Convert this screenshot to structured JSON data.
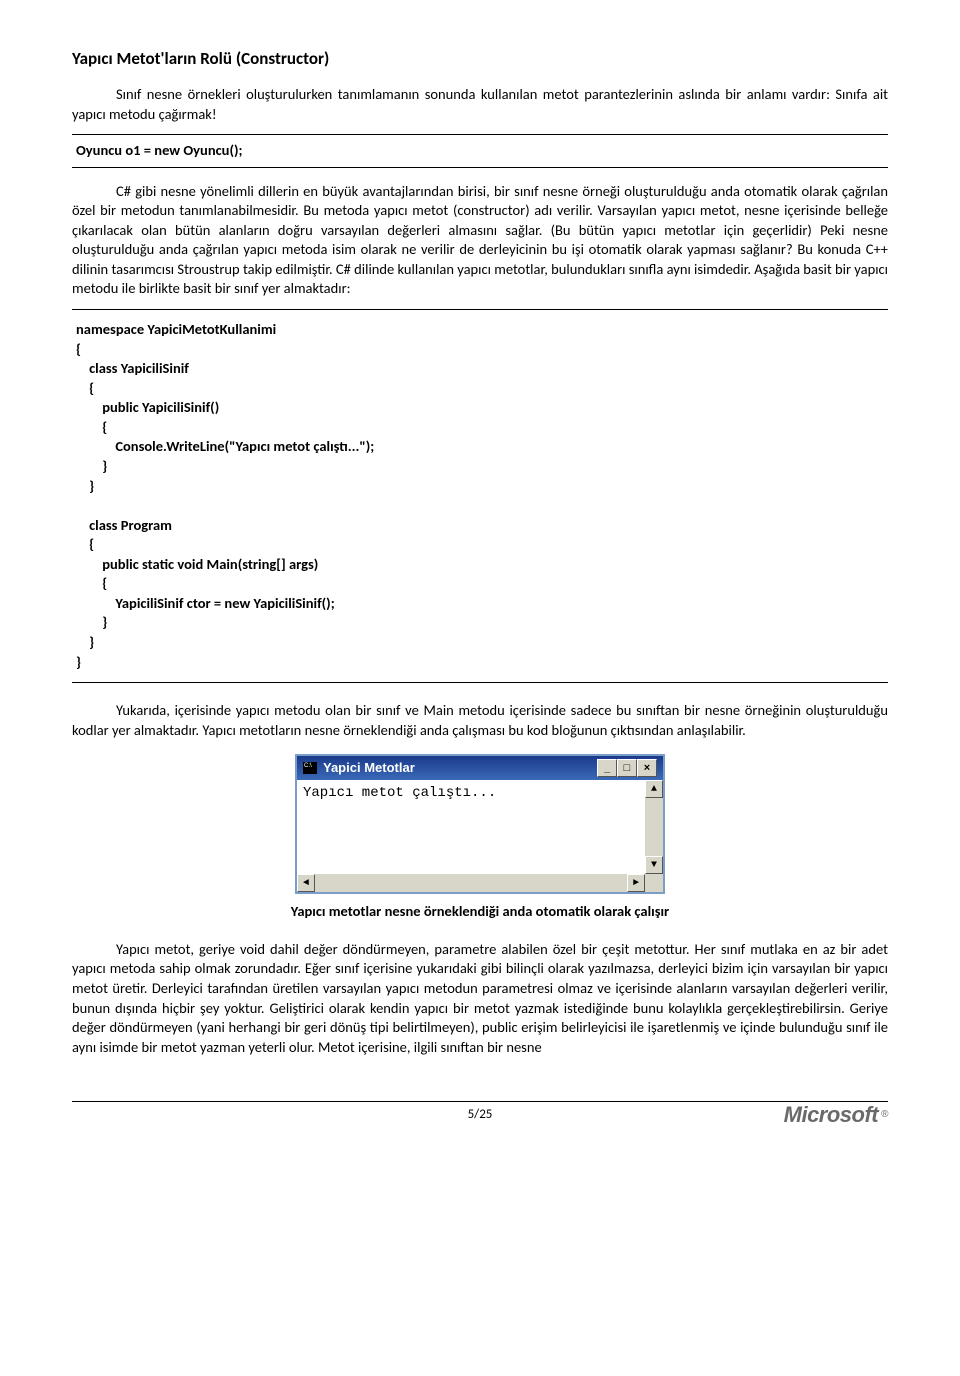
{
  "title": "Yapıcı Metot'ların Rolü (Constructor)",
  "intro": "Sınıf nesne örnekleri oluşturulurken tanımlamanın sonunda kullanılan metot parantezlerinin aslında bir anlamı vardır: Sınıfa ait yapıcı metodu çağırmak!",
  "code1": "   Oyuncu o1 = new Oyuncu();",
  "para2": "C# gibi nesne yönelimli dillerin en büyük avantajlarından birisi, bir sınıf nesne örneği oluşturulduğu anda otomatik olarak çağrılan özel bir metodun tanımlanabilmesidir. Bu metoda yapıcı metot (constructor) adı verilir. Varsayılan yapıcı metot, nesne içerisinde belleğe çıkarılacak olan bütün alanların doğru varsayılan değerleri almasını sağlar. (Bu bütün yapıcı metotlar için geçerlidir) Peki nesne oluşturulduğu anda çağrılan yapıcı metoda isim olarak ne verilir de derleyicinin bu işi otomatik olarak yapması sağlanır? Bu konuda C++ dilinin tasarımcısı Stroustrup takip edilmiştir. C# dilinde kullanılan yapıcı metotlar, bulundukları sınıfla aynı isimdedir. Aşağıda basit bir yapıcı metodu ile birlikte basit bir sınıf yer almaktadır:",
  "code2": "namespace YapiciMetotKullanimi\n{\n    class YapiciliSinif\n    {\n        public YapiciliSinif()\n        {\n            Console.WriteLine(\"Yapıcı metot çalıştı...\");\n        }\n    }\n\n    class Program\n    {\n        public static void Main(string[] args)\n        {\n            YapiciliSinif ctor = new YapiciliSinif();\n        }\n    }\n}",
  "para3": "Yukarıda, içerisinde yapıcı metodu olan bir sınıf ve Main metodu içerisinde sadece bu sınıftan bir nesne örneğinin oluşturulduğu kodlar yer almaktadır. Yapıcı metotların nesne örneklendiği anda çalışması bu kod bloğunun çıktısından anlaşılabilir.",
  "console": {
    "title": "Yapici Metotlar",
    "output": "Yapıcı metot çalıştı...",
    "min": "_",
    "max": "□",
    "close": "×"
  },
  "caption": "Yapıcı metotlar nesne örneklendiği anda otomatik olarak çalışır",
  "para4": "Yapıcı metot, geriye void dahil değer döndürmeyen, parametre alabilen özel bir çeşit metottur. Her sınıf mutlaka en az bir adet yapıcı metoda sahip olmak zorundadır. Eğer sınıf içerisine yukarıdaki gibi bilinçli olarak yazılmazsa, derleyici bizim için varsayılan bir yapıcı metot üretir. Derleyici tarafından üretilen varsayılan yapıcı metodun parametresi olmaz ve içerisinde alanların varsayılan değerleri verilir, bunun dışında hiçbir şey yoktur. Geliştirici olarak kendin yapıcı bir metot yazmak istediğinde bunu kolaylıkla gerçekleştirebilirsin. Geriye değer döndürmeyen (yani herhangi bir geri dönüş tipi belirtilmeyen), public erişim belirleyicisi ile işaretlenmiş ve içinde bulunduğu sınıf ile aynı isimde bir metot yazman yeterli olur. Metot içerisine, ilgili sınıftan bir nesne",
  "pageNo": "5/25",
  "logo": "Microsoft",
  "reg": "®"
}
